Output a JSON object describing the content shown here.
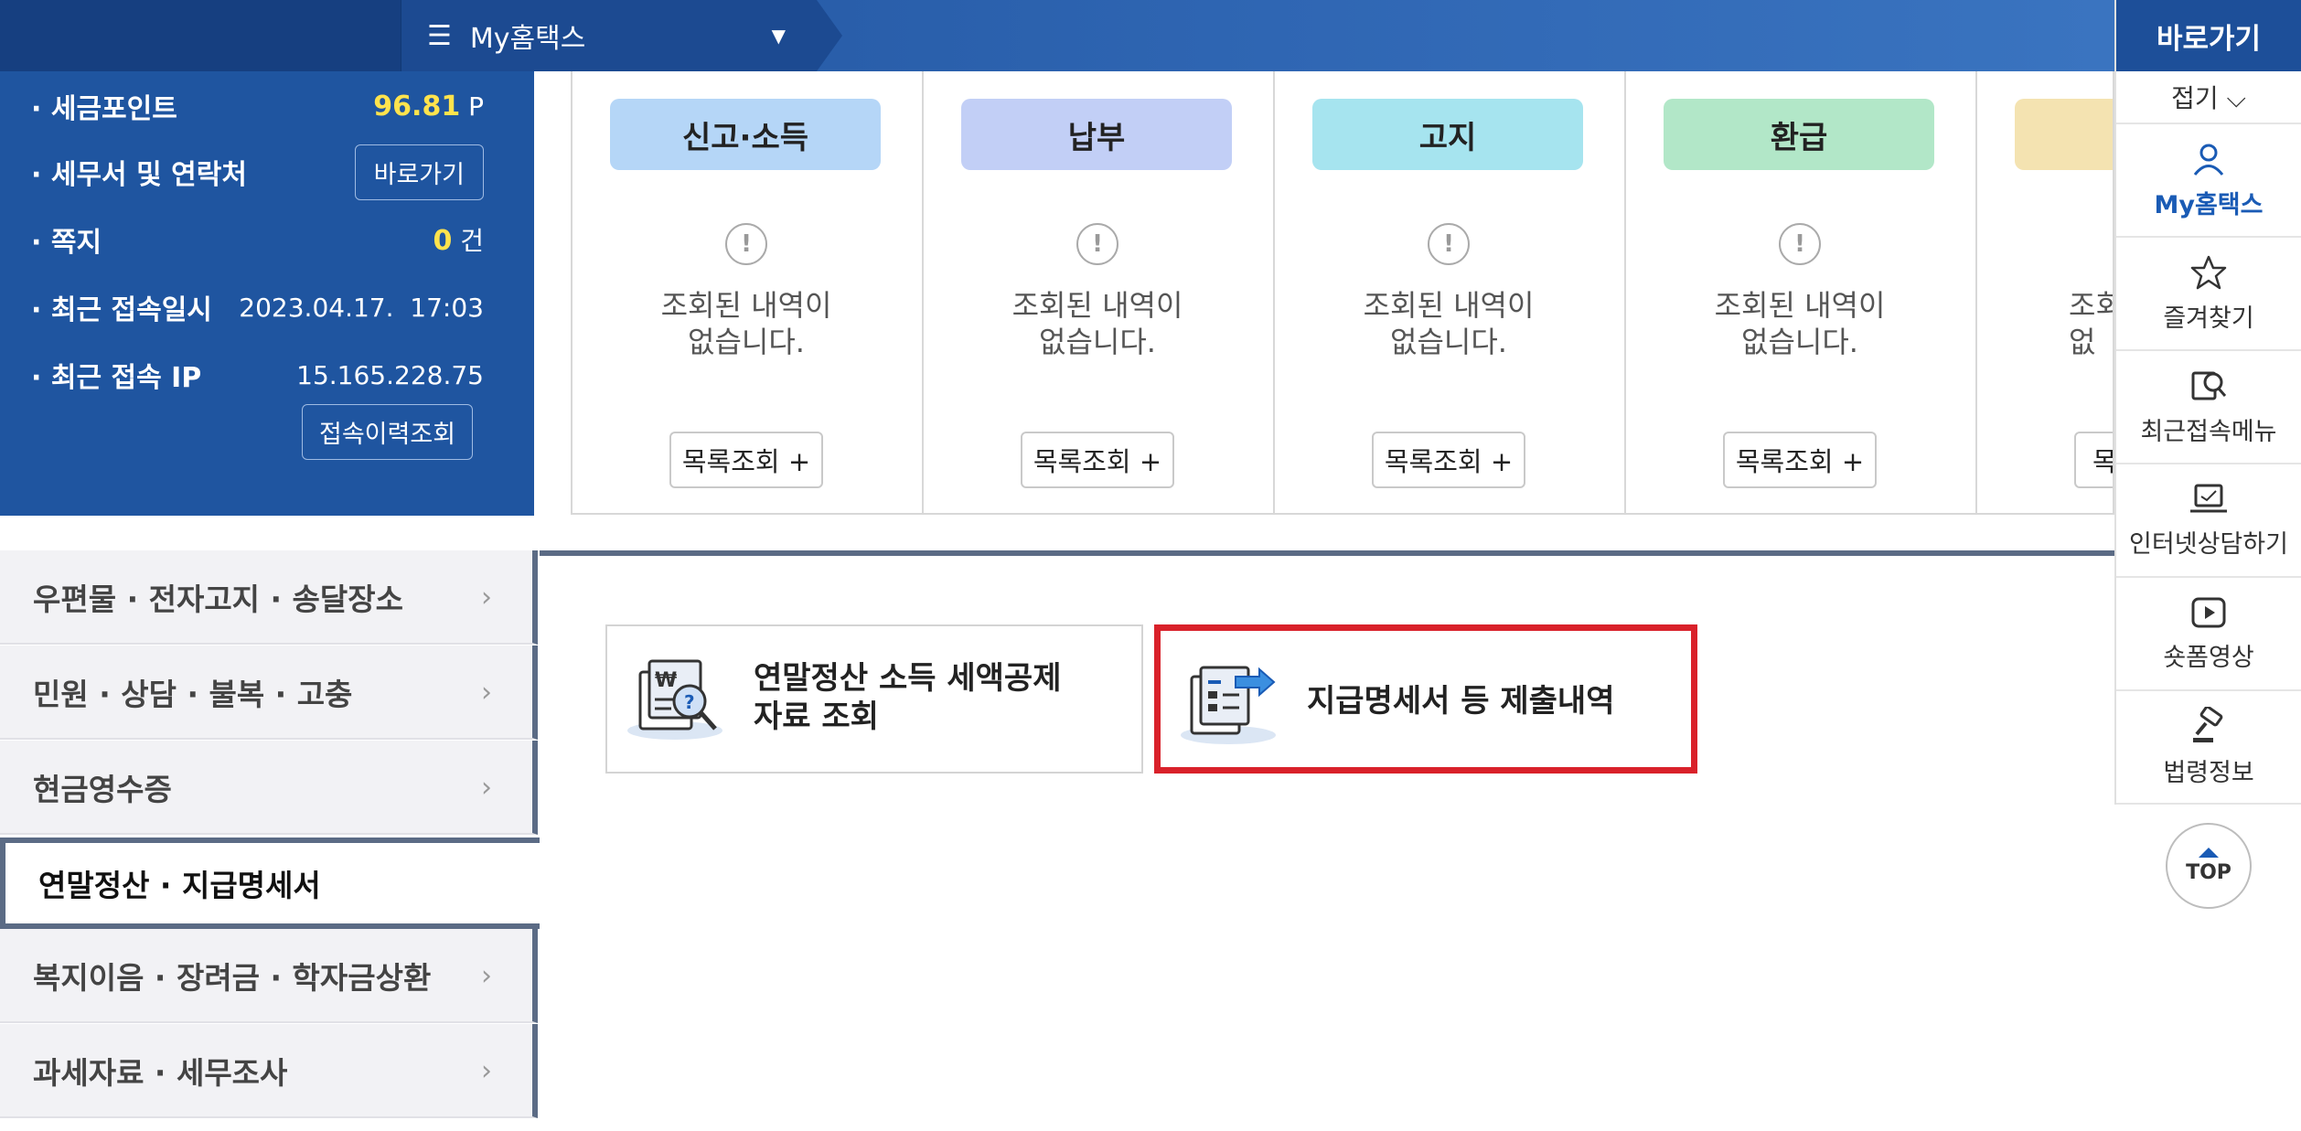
{
  "topbar": {
    "menu_label": "My홈택스",
    "menu_icon": "hamburger-icon",
    "caret_icon": "caret-down-icon"
  },
  "info": {
    "tax_point_label": "세금포인트",
    "tax_point_value": "96.81",
    "tax_point_unit": "P",
    "tax_office_label": "세무서 및 연락처",
    "tax_office_button": "바로가기",
    "message_label": "쪽지",
    "message_value": "0",
    "message_unit": "건",
    "last_login_label": "최근 접속일시",
    "last_login_value": "2023.04.17.  17:03",
    "last_ip_label": "최근 접속 IP",
    "last_ip_value": "15.165.228.75",
    "history_button": "접속이력조회"
  },
  "cards": [
    {
      "title": "신고·소득",
      "color": "#b5d6f7",
      "msg": "조회된 내역이\n없습니다.",
      "button": "목록조회 +"
    },
    {
      "title": "납부",
      "color": "#c2cff6",
      "msg": "조회된 내역이\n없습니다.",
      "button": "목록조회 +"
    },
    {
      "title": "고지",
      "color": "#a6e4ef",
      "msg": "조회된 내역이\n없습니다.",
      "button": "목록조회 +"
    },
    {
      "title": "환급",
      "color": "#b2e7c8",
      "msg": "조회된 내역이\n없습니다.",
      "button": "목록조회 +"
    },
    {
      "title": "",
      "color": "#f4e3b1",
      "msg": "조회\n없",
      "button": "목"
    }
  ],
  "nav": [
    {
      "label": "우편물 · 전자고지 · 송달장소"
    },
    {
      "label": "민원 · 상담 · 불복 · 고충"
    },
    {
      "label": "현금영수증"
    },
    {
      "label": "연말정산 · 지급명세서",
      "active": true
    },
    {
      "label": "복지이음 · 장려금 · 학자금상환"
    },
    {
      "label": "과세자료 · 세무조사"
    }
  ],
  "tiles": [
    {
      "title": "연말정산 소득 세액공제\n자료 조회",
      "icon": "tax-search-document-icon"
    },
    {
      "title": "지급명세서 등 제출내역",
      "icon": "document-submit-icon",
      "highlight_color": "#d9212a"
    }
  ],
  "quick": {
    "header": "바로가기",
    "fold": "접기 ⌵",
    "items": [
      {
        "label": "My홈택스",
        "icon": "user-icon"
      },
      {
        "label": "즐겨찾기",
        "icon": "star-icon"
      },
      {
        "label": "최근접속메뉴",
        "icon": "recent-menu-icon"
      },
      {
        "label": "인터넷상담하기",
        "icon": "laptop-icon"
      },
      {
        "label": "숏폼영상",
        "icon": "video-play-icon"
      },
      {
        "label": "법령정보",
        "icon": "gavel-icon"
      }
    ],
    "top_label": "TOP"
  }
}
